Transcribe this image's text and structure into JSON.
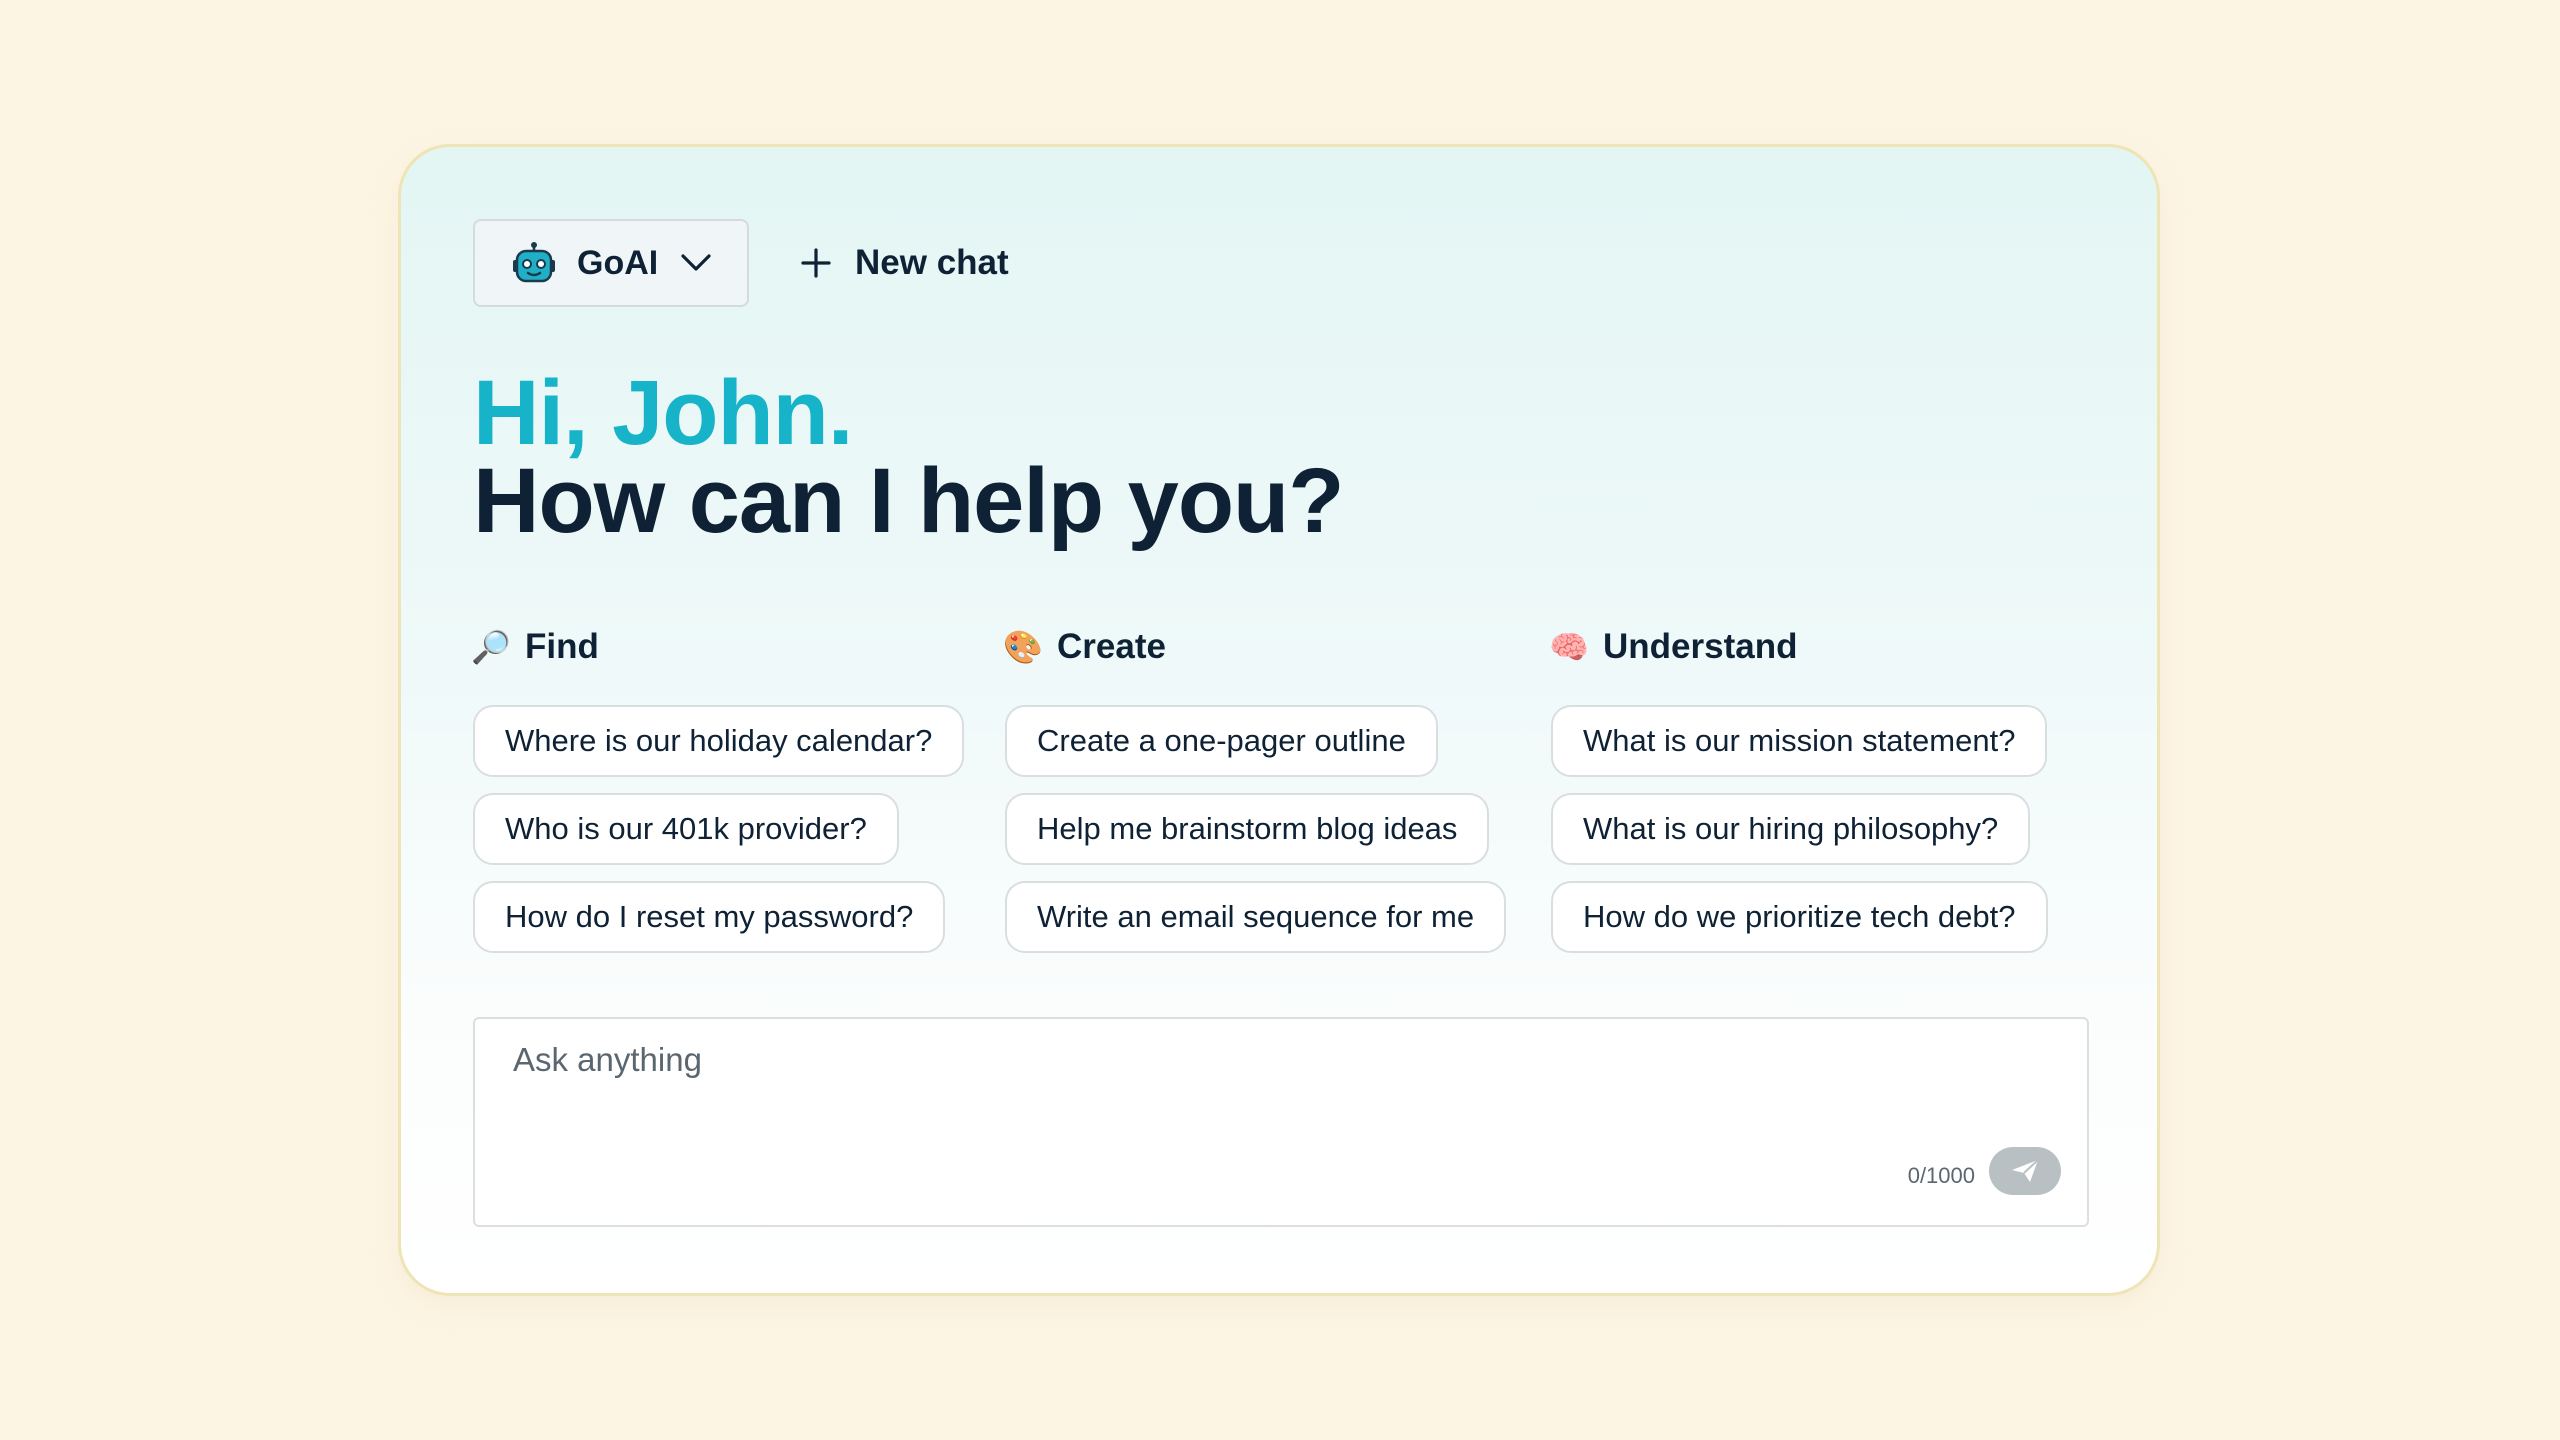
{
  "header": {
    "model_label": "GoAI",
    "new_chat_label": "New chat"
  },
  "greeting": {
    "hi": "Hi, John.",
    "help": "How can I help you?"
  },
  "columns": [
    {
      "emoji": "🔎",
      "icon": "magnifier-icon",
      "title": "Find",
      "prompts": [
        "Where is our holiday calendar?",
        "Who is our 401k provider?",
        "How do I reset my password?"
      ]
    },
    {
      "emoji": "🎨",
      "icon": "palette-icon",
      "title": "Create",
      "prompts": [
        "Create a one-pager outline",
        "Help me brainstorm blog ideas",
        "Write an email sequence for me"
      ]
    },
    {
      "emoji": "🧠",
      "icon": "brain-icon",
      "title": "Understand",
      "prompts": [
        "What is our mission statement?",
        "What is our hiring philosophy?",
        "How do we prioritize tech debt?"
      ]
    }
  ],
  "input": {
    "placeholder": "Ask anything",
    "counter": "0/1000"
  },
  "colors": {
    "accent": "#16b3c9",
    "text": "#0f2235",
    "background": "#fdf5e4",
    "send_disabled": "#b9c0c4"
  }
}
